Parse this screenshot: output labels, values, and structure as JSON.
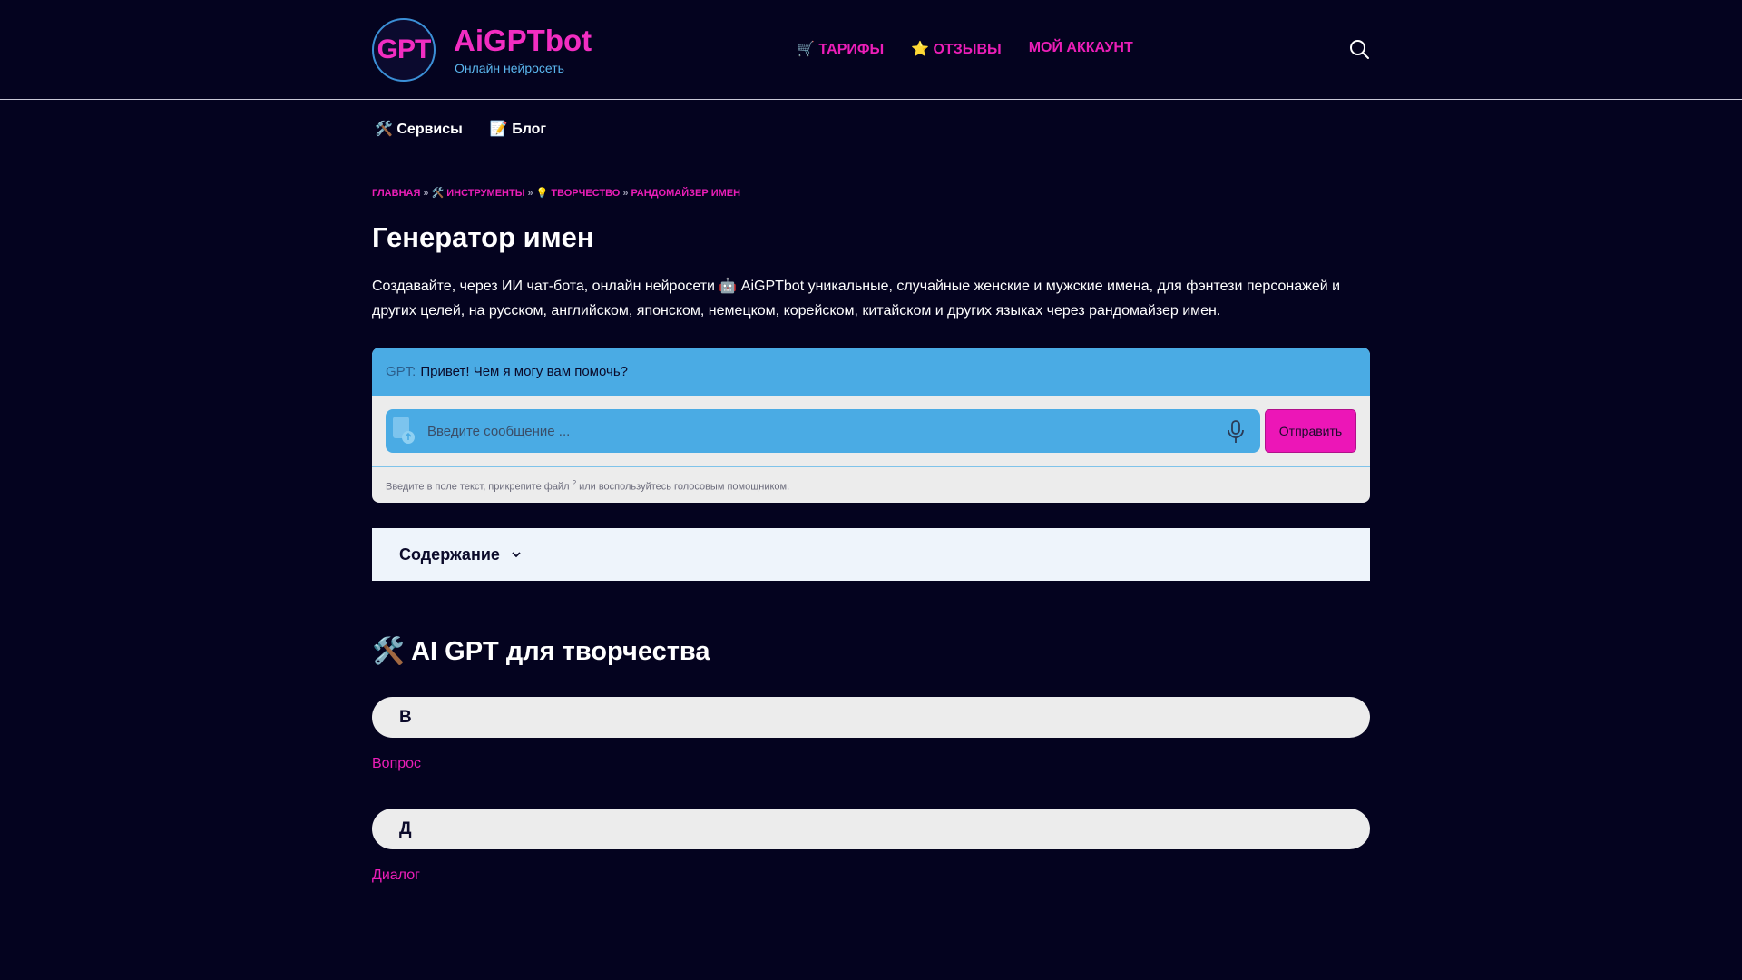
{
  "header": {
    "logo_text": "GPT",
    "brand_name": "AiGPTbot",
    "brand_sub": "Онлайн нейросеть",
    "nav": [
      {
        "label": "🛒 ТАРИФЫ"
      },
      {
        "label": "⭐ ОТЗЫВЫ"
      },
      {
        "label": "МОЙ АККАУНТ"
      }
    ],
    "search_icon": "search-icon"
  },
  "subnav": [
    {
      "label": "🛠️ Сервисы"
    },
    {
      "label": "📝 Блог"
    }
  ],
  "breadcrumb": {
    "items": [
      "ГЛАВНАЯ",
      "🛠️ ИНСТРУМЕНТЫ",
      "💡 ТВОРЧЕСТВО",
      "РАНДОМАЙЗЕР ИМЕН"
    ],
    "separator": "»"
  },
  "page": {
    "title": "Генератор имен",
    "intro": "Создавайте, через ИИ чат-бота, онлайн нейросети 🤖 AiGPTbot уникальные, случайные женские и мужские имена, для фэнтези персонажей и других целей, на русском, английском, японском, немецком, корейском, китайском и других языках через рандомайзер имен."
  },
  "chat": {
    "sender": "GPT:",
    "message": "Привет! Чем я могу вам помочь?",
    "input_placeholder": "Введите сообщение ...",
    "send_label": "Отправить",
    "hint_before": "Введите в поле текст, прикрепите файл",
    "hint_sup": "?",
    "hint_after": "или воспользуйтесь голосовым помощником."
  },
  "toc": {
    "label": "Содержание"
  },
  "section": {
    "title": "🛠️ AI GPT для творчества",
    "groups": [
      {
        "letter": "В",
        "link": "Вопрос"
      },
      {
        "letter": "Д",
        "link": "Диалог"
      }
    ]
  },
  "colors": {
    "background": "#04031f",
    "accent_pink": "#ec1eb8",
    "accent_blue": "#4aabe4"
  }
}
